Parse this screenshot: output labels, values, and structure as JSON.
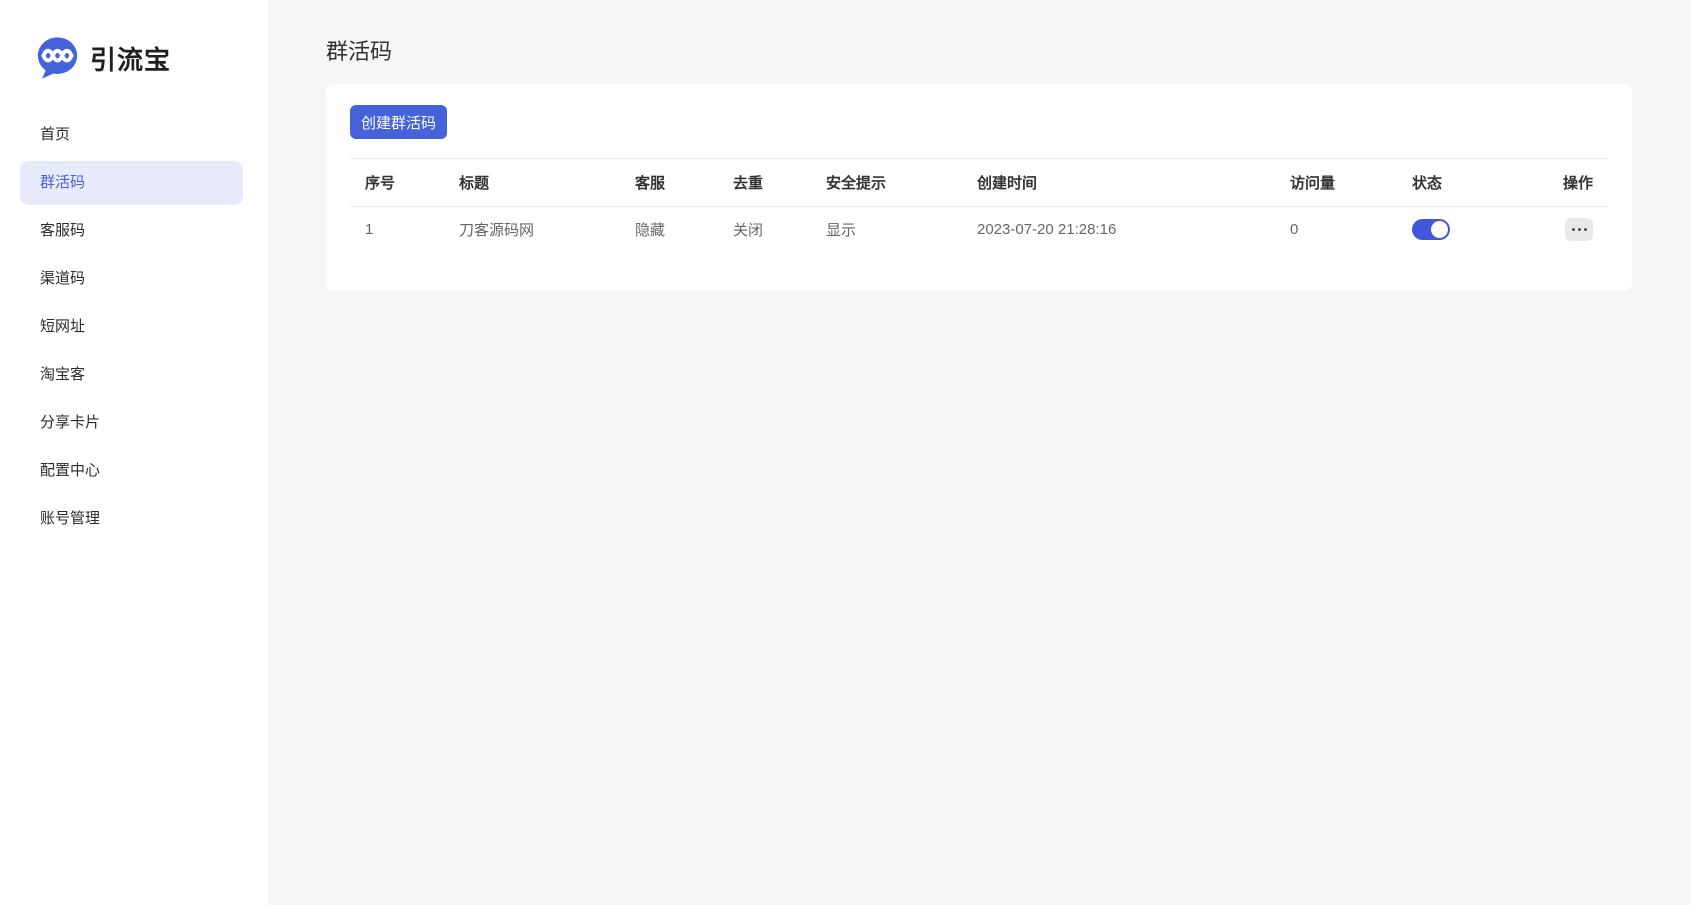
{
  "app": {
    "brand": "引流宝",
    "logo_icon": "chat-bubble-weave-icon"
  },
  "colors": {
    "primary": "#4662da",
    "primary_light_bg": "#e7eafa",
    "page_background": "#f5f6f8",
    "toggle_on": "#3f57d8"
  },
  "sidebar": {
    "items": [
      {
        "label": "首页",
        "active": false
      },
      {
        "label": "群活码",
        "active": true
      },
      {
        "label": "客服码",
        "active": false
      },
      {
        "label": "渠道码",
        "active": false
      },
      {
        "label": "短网址",
        "active": false
      },
      {
        "label": "淘宝客",
        "active": false
      },
      {
        "label": "分享卡片",
        "active": false
      },
      {
        "label": "配置中心",
        "active": false
      },
      {
        "label": "账号管理",
        "active": false
      }
    ]
  },
  "page": {
    "title": "群活码"
  },
  "toolbar": {
    "create_button_label": "创建群活码"
  },
  "table": {
    "headers": [
      "序号",
      "标题",
      "客服",
      "去重",
      "安全提示",
      "创建时间",
      "访问量",
      "状态",
      "操作"
    ],
    "rows": [
      {
        "index": "1",
        "title": "刀客源码网",
        "service": "隐藏",
        "dedupe": "关闭",
        "security_tip": "显示",
        "created_at": "2023-07-20 21:28:16",
        "visits": "0",
        "status_on": true,
        "actions_icon": "ellipsis-icon"
      }
    ]
  }
}
